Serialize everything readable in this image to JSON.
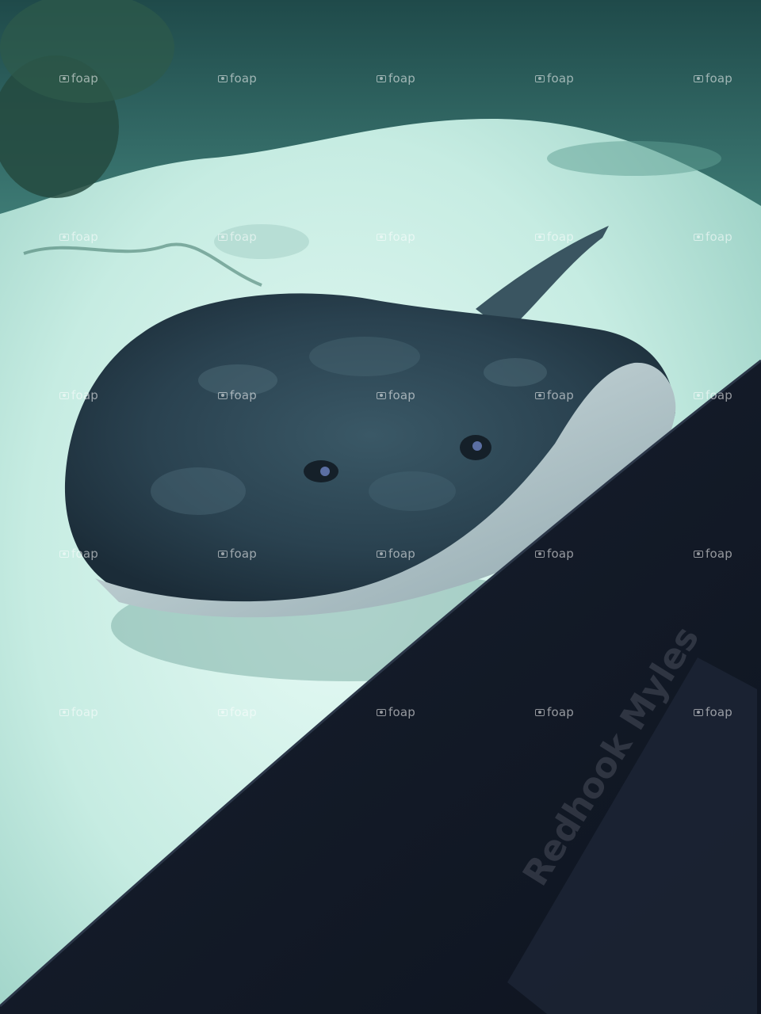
{
  "watermark": {
    "label": "foap"
  },
  "sign": {
    "text": "Redhook Myles"
  },
  "colors": {
    "water": "#2a5a5e",
    "sand": "#cfeee6",
    "ray_body": "#243845",
    "ray_underside": "#b9c9cc",
    "wall": "#141c2b"
  },
  "elements": {
    "subject": "stingray",
    "setting": "aquarium-tank"
  }
}
